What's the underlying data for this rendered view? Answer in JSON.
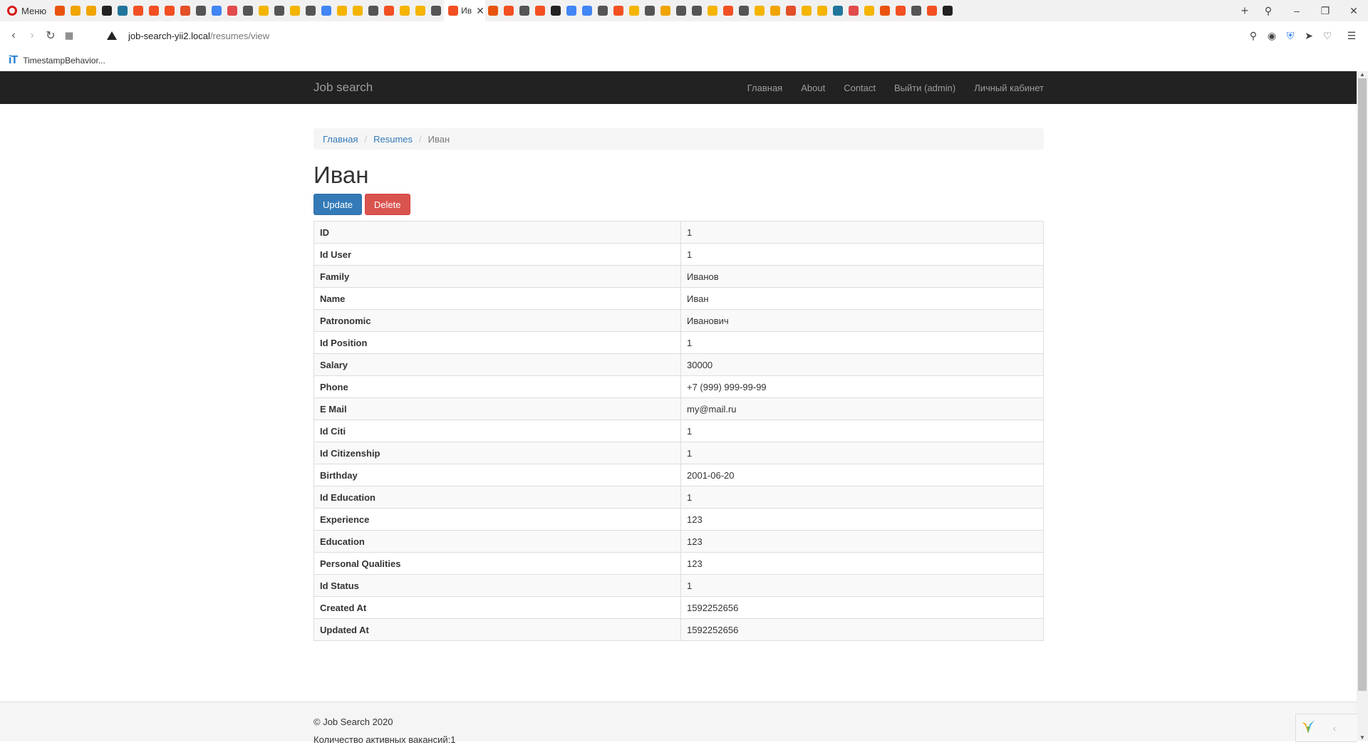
{
  "browser": {
    "menu_label": "Меню",
    "active_tab_title": "Ив",
    "url_host": "job-search-yii2.local",
    "url_path": "/resumes/view",
    "bookmark_label": "TimestampBehavior...",
    "tab_icons": [
      "#e8540f",
      "#f0a400",
      "#f0a400",
      "#222",
      "#21759b",
      "#f25022",
      "#f25022",
      "#f25022",
      "#e34f26",
      "#555",
      "#4285f4",
      "#e24b4b",
      "#555",
      "#f4b400",
      "#555",
      "#f4b400",
      "#555",
      "#4285f4",
      "#f4b400",
      "#f4b400",
      "#555",
      "#f25022",
      "#f4b400",
      "#f4b400",
      "#555"
    ]
  },
  "navbar": {
    "brand": "Job search",
    "links": [
      "Главная",
      "About",
      "Contact",
      "Выйти (admin)",
      "Личный кабинет"
    ]
  },
  "breadcrumb": {
    "home": "Главная",
    "section": "Resumes",
    "current": "Иван"
  },
  "page": {
    "title": "Иван",
    "update_label": "Update",
    "delete_label": "Delete"
  },
  "details": [
    {
      "label": "ID",
      "value": "1"
    },
    {
      "label": "Id User",
      "value": "1"
    },
    {
      "label": "Family",
      "value": "Иванов"
    },
    {
      "label": "Name",
      "value": "Иван"
    },
    {
      "label": "Patronomic",
      "value": "Иванович"
    },
    {
      "label": "Id Position",
      "value": "1"
    },
    {
      "label": "Salary",
      "value": "30000"
    },
    {
      "label": "Phone",
      "value": "+7 (999) 999-99-99"
    },
    {
      "label": "E Mail",
      "value": "my@mail.ru"
    },
    {
      "label": "Id Citi",
      "value": "1"
    },
    {
      "label": "Id Citizenship",
      "value": "1"
    },
    {
      "label": "Birthday",
      "value": "2001-06-20"
    },
    {
      "label": "Id Education",
      "value": "1"
    },
    {
      "label": "Experience",
      "value": "123"
    },
    {
      "label": "Education",
      "value": "123"
    },
    {
      "label": "Personal Qualities",
      "value": "123"
    },
    {
      "label": "Id Status",
      "value": "1"
    },
    {
      "label": "Created At",
      "value": "1592252656"
    },
    {
      "label": "Updated At",
      "value": "1592252656"
    }
  ],
  "footer": {
    "copyright": "© Job Search 2020",
    "vacancies": "Количество активных вакансий:1"
  }
}
